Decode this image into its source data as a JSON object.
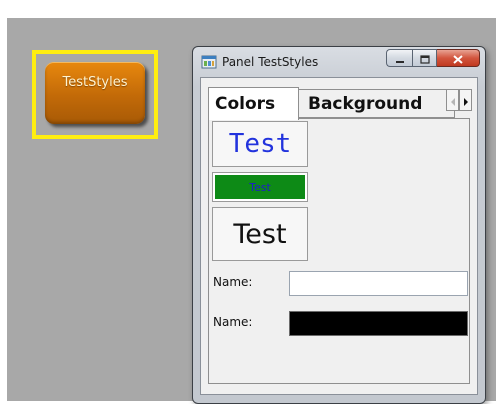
{
  "desktop": {
    "tile_button_label": "TestStyles"
  },
  "window": {
    "title": "Panel TestStyles",
    "icon": "app-window-icon",
    "caption_buttons": [
      "minimize-icon",
      "maximize-icon",
      "close-icon"
    ]
  },
  "tabs": {
    "items": [
      {
        "label": "Colors",
        "selected": true
      },
      {
        "label": "Background",
        "selected": false
      }
    ],
    "scroll_left_icon": "◂",
    "scroll_right_icon": "▸"
  },
  "panel": {
    "button_1_label": "Test",
    "button_2_label": "Test",
    "button_3_label": "Test",
    "name_label_1": "Name:",
    "name_label_2": "Name:",
    "name_value_1": "",
    "name_value_2": ""
  },
  "colors": {
    "desktop_background": "#a8a8a8",
    "selection_outline": "#ffee11",
    "tile_orange": "#c26a08",
    "button_1_text": "#2233dd",
    "button_2_background": "#0d8a16",
    "button_2_text": "#1d1dcc",
    "field_2_background": "#000000"
  }
}
